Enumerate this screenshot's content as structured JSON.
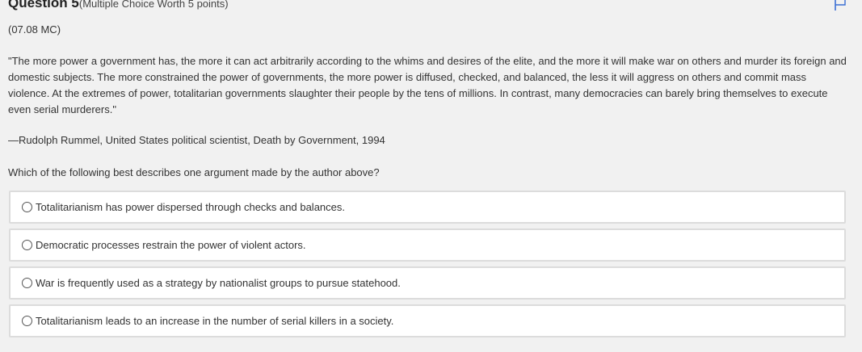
{
  "question": {
    "title": "Question 5",
    "meta": "(Multiple Choice Worth 5 points)",
    "code": "(07.08 MC)",
    "quote": "\"The more power a government has, the more it can act arbitrarily according to the whims and desires of the elite, and the more it will make war on others and murder its foreign and domestic subjects. The more constrained the power of governments, the more power is diffused, checked, and balanced, the less it will aggress on others and commit mass violence. At the extremes of power, totalitarian governments slaughter their people by the tens of millions. In contrast, many democracies can barely bring themselves to execute even serial murderers.\"",
    "attribution": "—Rudolph Rummel, United States political scientist, Death by Government, 1994",
    "prompt": "Which of the following best describes one argument made by the author above?",
    "choices": [
      {
        "label": "Totalitarianism has power dispersed through checks and balances.",
        "selected": false
      },
      {
        "label": "Democratic processes restrain the power of violent actors.",
        "selected": false
      },
      {
        "label": "War is frequently used as a strategy by nationalist groups to pursue statehood.",
        "selected": false
      },
      {
        "label": "Totalitarianism leads to an increase in the number of serial killers in a society.",
        "selected": false
      }
    ]
  },
  "icons": {
    "flag": "flag-icon"
  },
  "colors": {
    "background": "#f1f1f1",
    "choice_background": "#ffffff",
    "choice_border": "#dcdcdc",
    "flag": "#3b6fd4"
  }
}
